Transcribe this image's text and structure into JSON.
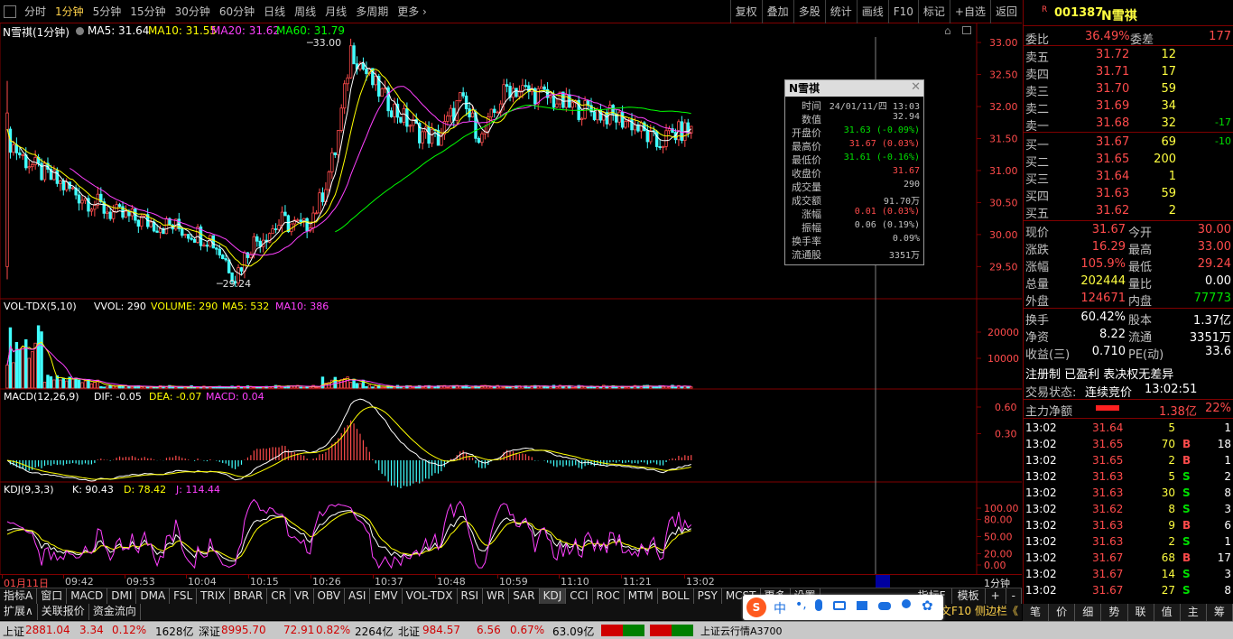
{
  "topbar": {
    "timeframes": [
      "分时",
      "1分钟",
      "5分钟",
      "15分钟",
      "30分钟",
      "60分钟",
      "日线",
      "周线",
      "月线",
      "多周期",
      "更多"
    ],
    "active_index": 1,
    "tools": [
      "复权",
      "叠加",
      "多股",
      "统计",
      "画线",
      "F10",
      "标记",
      "+自选",
      "返回"
    ]
  },
  "info": {
    "name": "N雪祺(1分钟)",
    "ma5": "MA5: 31.64",
    "ma10": "MA10: 31.55",
    "ma20": "MA20: 31.62",
    "ma60": "MA60: 31.79"
  },
  "price_axis": [
    "33.00",
    "32.50",
    "32.00",
    "31.50",
    "31.00",
    "30.50",
    "30.00",
    "29.50"
  ],
  "chart_labels": {
    "high": "33.00",
    "low": "29.24"
  },
  "vol": {
    "title": "VOL-TDX(5,10)",
    "vvol": "VVOL: 290",
    "volume": "VOLUME: 290",
    "ma5": "MA5: 532",
    "ma10": "MA10: 386",
    "axis": [
      "20000",
      "10000"
    ]
  },
  "macd": {
    "title": "MACD(12,26,9)",
    "dif": "DIF: -0.05",
    "dea": "DEA: -0.07",
    "macd": "MACD: 0.04",
    "axis": [
      "0.60",
      "0.30"
    ]
  },
  "kdj": {
    "title": "KDJ(9,3,3)",
    "k": "K: 90.43",
    "d": "D: 78.42",
    "j": "J: 114.44",
    "axis": [
      "100.00",
      "80.00",
      "50.00",
      "20.00",
      "0.00"
    ]
  },
  "time_axis": [
    "01月11日",
    "09:42",
    "09:53",
    "10:04",
    "10:15",
    "10:26",
    "10:37",
    "10:48",
    "10:59",
    "11:10",
    "11:21",
    "13:02"
  ],
  "period_label": "1分钟",
  "popup": {
    "title": "N雪祺",
    "rows": [
      {
        "k": "时间",
        "v": "24/01/11/四 13:03",
        "c": "gry"
      },
      {
        "k": "数值",
        "v": "32.94",
        "c": "gry"
      },
      {
        "k": "开盘价",
        "v": "31.63 (-0.09%)",
        "c": "grn"
      },
      {
        "k": "最高价",
        "v": "31.67 (0.03%)",
        "c": "red"
      },
      {
        "k": "最低价",
        "v": "31.61 (-0.16%)",
        "c": "grn"
      },
      {
        "k": "收盘价",
        "v": "31.67",
        "c": "red"
      },
      {
        "k": "成交量",
        "v": "290",
        "c": "gry"
      },
      {
        "k": "成交额",
        "v": "91.70万",
        "c": "gry"
      },
      {
        "k": "涨幅",
        "v": "0.01 (0.03%)",
        "c": "red"
      },
      {
        "k": "振幅",
        "v": "0.06 (0.19%)",
        "c": "gry"
      },
      {
        "k": "换手率",
        "v": "0.09%",
        "c": "gry"
      },
      {
        "k": "流通股",
        "v": "3351万",
        "c": "gry"
      }
    ]
  },
  "stock": {
    "badge": "R",
    "code": "001387",
    "name": "N雪祺"
  },
  "weibi": {
    "label1": "委比",
    "v1": "36.49%",
    "label2": "委差",
    "v2": "177"
  },
  "asks": [
    {
      "l": "卖五",
      "p": "31.72",
      "q": "12",
      "d": ""
    },
    {
      "l": "卖四",
      "p": "31.71",
      "q": "17",
      "d": ""
    },
    {
      "l": "卖三",
      "p": "31.70",
      "q": "59",
      "d": ""
    },
    {
      "l": "卖二",
      "p": "31.69",
      "q": "34",
      "d": ""
    },
    {
      "l": "卖一",
      "p": "31.68",
      "q": "32",
      "d": "-17"
    }
  ],
  "bids": [
    {
      "l": "买一",
      "p": "31.67",
      "q": "69",
      "d": "-10"
    },
    {
      "l": "买二",
      "p": "31.65",
      "q": "200",
      "d": ""
    },
    {
      "l": "买三",
      "p": "31.64",
      "q": "1",
      "d": ""
    },
    {
      "l": "买四",
      "p": "31.63",
      "q": "59",
      "d": ""
    },
    {
      "l": "买五",
      "p": "31.62",
      "q": "2",
      "d": ""
    }
  ],
  "quote": [
    {
      "l1": "现价",
      "v1": "31.67",
      "c1": "red",
      "l2": "今开",
      "v2": "30.00",
      "c2": "red"
    },
    {
      "l1": "涨跌",
      "v1": "16.29",
      "c1": "red",
      "l2": "最高",
      "v2": "33.00",
      "c2": "red"
    },
    {
      "l1": "涨幅",
      "v1": "105.9%",
      "c1": "red",
      "l2": "最低",
      "v2": "29.24",
      "c2": "red"
    },
    {
      "l1": "总量",
      "v1": "202444",
      "c1": "ylw",
      "l2": "量比",
      "v2": "0.00",
      "c2": "wht"
    },
    {
      "l1": "外盘",
      "v1": "124671",
      "c1": "red",
      "l2": "内盘",
      "v2": "77773",
      "c2": "grn"
    }
  ],
  "fund": [
    {
      "l1": "换手",
      "v1": "60.42%",
      "l2": "股本",
      "v2": "1.37亿"
    },
    {
      "l1": "净资",
      "v1": "8.22",
      "l2": "流通",
      "v2": "3351万"
    },
    {
      "l1": "收益(三)",
      "v1": "0.710",
      "l2": "PE(动)",
      "v2": "33.6"
    }
  ],
  "tags": "注册制 已盈利 表决权无差异",
  "trade_status": {
    "label": "交易状态:",
    "value": "连续竞价",
    "time": "13:02:51"
  },
  "main_flow": {
    "label": "主力净额",
    "value": "1.38亿",
    "pct": "22%"
  },
  "ticks": [
    {
      "t": "13:02",
      "p": "31.64",
      "q": "5",
      "bs": "",
      "n": "1"
    },
    {
      "t": "13:02",
      "p": "31.65",
      "q": "70",
      "bs": "B",
      "n": "18"
    },
    {
      "t": "13:02",
      "p": "31.65",
      "q": "2",
      "bs": "B",
      "n": "1"
    },
    {
      "t": "13:02",
      "p": "31.63",
      "q": "5",
      "bs": "S",
      "n": "2"
    },
    {
      "t": "13:02",
      "p": "31.63",
      "q": "30",
      "bs": "S",
      "n": "8"
    },
    {
      "t": "13:02",
      "p": "31.62",
      "q": "8",
      "bs": "S",
      "n": "3"
    },
    {
      "t": "13:02",
      "p": "31.63",
      "q": "9",
      "bs": "B",
      "n": "6"
    },
    {
      "t": "13:02",
      "p": "31.63",
      "q": "2",
      "bs": "S",
      "n": "1"
    },
    {
      "t": "13:02",
      "p": "31.67",
      "q": "68",
      "bs": "B",
      "n": "17"
    },
    {
      "t": "13:02",
      "p": "31.67",
      "q": "14",
      "bs": "S",
      "n": "3"
    },
    {
      "t": "13:02",
      "p": "31.67",
      "q": "27",
      "bs": "S",
      "n": "8"
    }
  ],
  "indicator_tabs": [
    "指标A",
    "窗口",
    "MACD",
    "DMI",
    "DMA",
    "FSL",
    "TRIX",
    "BRAR",
    "CR",
    "VR",
    "OBV",
    "ASI",
    "EMV",
    "VOL-TDX",
    "RSI",
    "WR",
    "SAR",
    "KDJ",
    "CCI",
    "ROC",
    "MTM",
    "BOLL",
    "PSY",
    "MCST",
    "更多",
    "设置"
  ],
  "indicator_right": [
    "指标F",
    "模板",
    "+",
    "-"
  ],
  "sub_tabs": [
    "扩展∧",
    "关联报价",
    "资金流向"
  ],
  "right_bottom_tabs": [
    "笔",
    "价",
    "细",
    "势",
    "联",
    "值",
    "主",
    "筹"
  ],
  "sub_right": "文F10 侧边栏《",
  "statusbar": {
    "sh_label": "上证",
    "sh_val": "2881.04",
    "sh_chg": "3.34",
    "sh_pct": "0.12%",
    "sh_amt": "1628亿",
    "sz_label": "深证",
    "sz_val": "8995.70",
    "sz_chg": "72.91",
    "sz_pct": "0.82%",
    "sz_amt": "2264亿",
    "bz_label": "北证",
    "bz_val": "984.57",
    "bz_chg": "6.56",
    "bz_pct": "0.67%",
    "bz_amt": "63.09亿",
    "server": "上证云行情A3700"
  },
  "ime": {
    "logo": "S",
    "lang": "中"
  },
  "colors": {
    "up": "#ff4b4b",
    "down": "#40ffff",
    "ma5": "#ffffff",
    "ma10": "#ffff00",
    "ma20": "#ff40ff",
    "ma60": "#00ff00",
    "frame": "#800000"
  }
}
